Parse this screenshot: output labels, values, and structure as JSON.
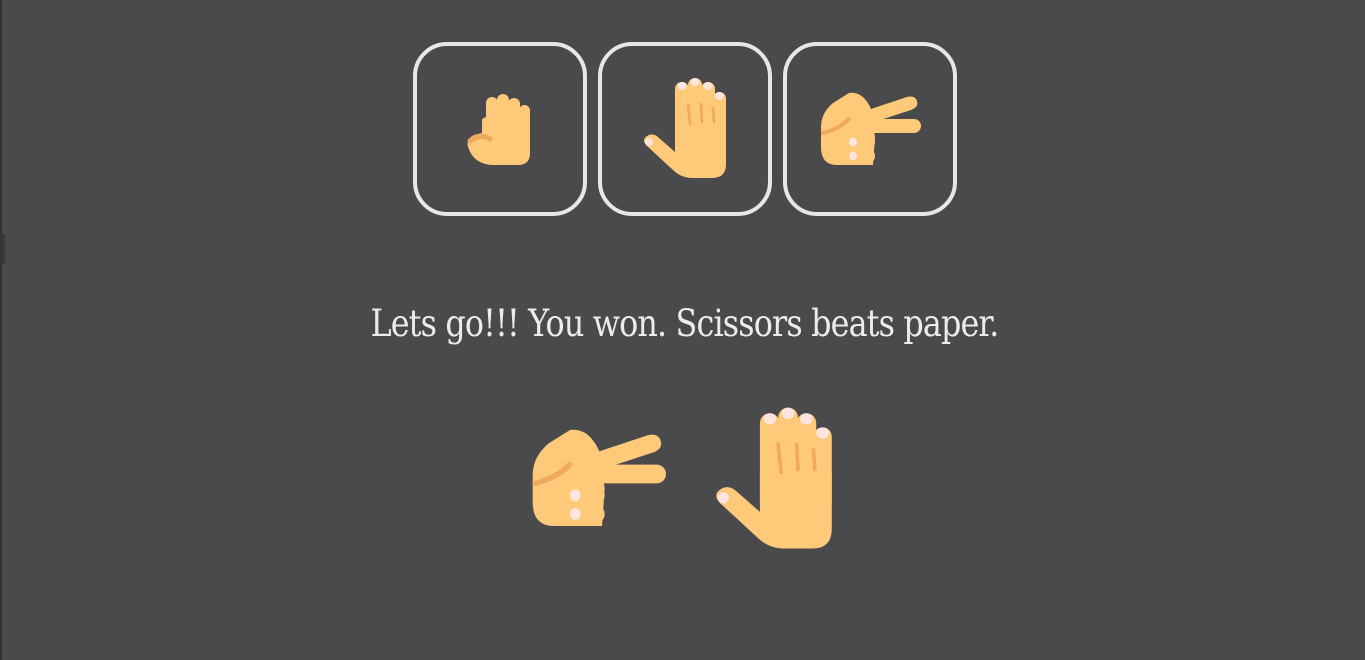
{
  "game": {
    "choices": [
      {
        "id": "rock",
        "icon": "rock-fist-icon"
      },
      {
        "id": "paper",
        "icon": "paper-hand-icon"
      },
      {
        "id": "scissors",
        "icon": "scissors-hand-icon"
      }
    ],
    "result_message": "Lets go!!! You won. Scissors beats paper.",
    "player_choice": "scissors",
    "computer_choice": "paper"
  },
  "colors": {
    "background": "#4a494c",
    "button_border": "#e7e7e9",
    "text": "#ececec",
    "skin": "#ffc97a",
    "skin_shadow": "#f0a85f",
    "nail": "#ffe4e0"
  }
}
